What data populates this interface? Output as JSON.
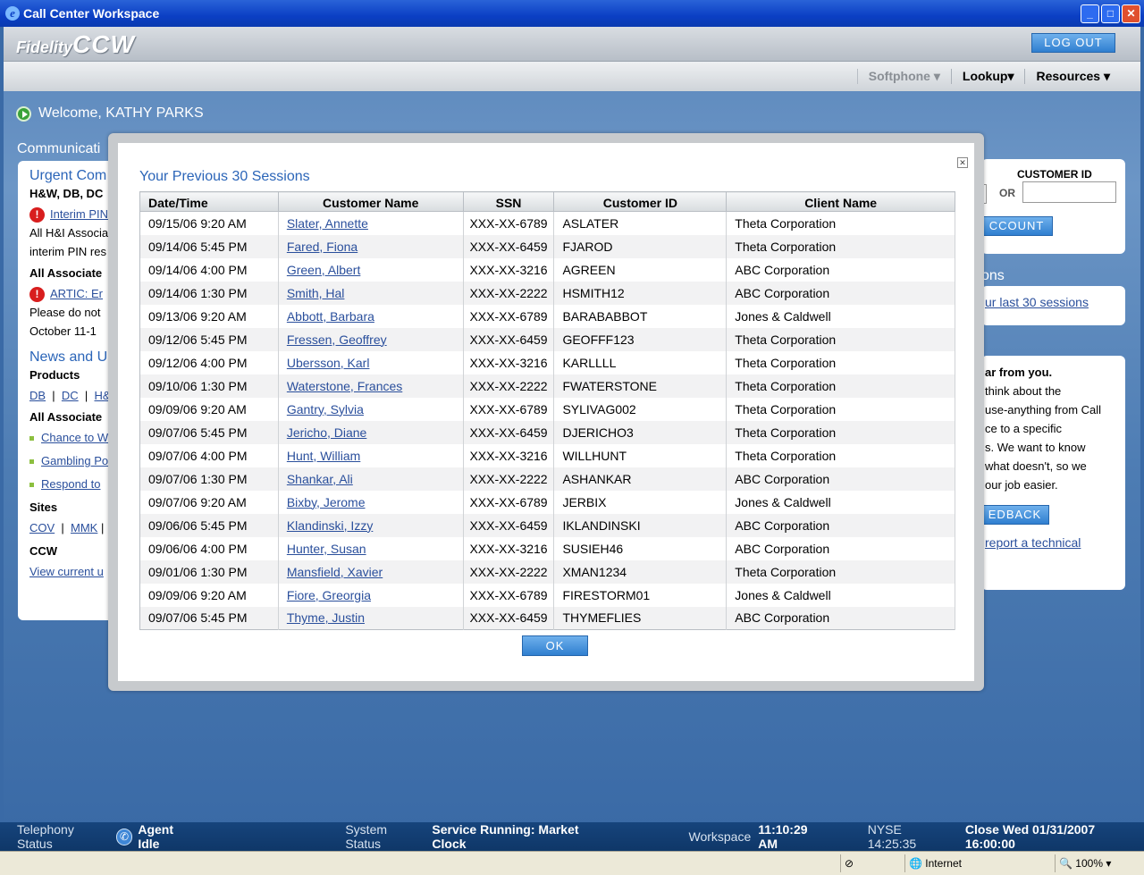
{
  "window": {
    "title": "Call Center Workspace"
  },
  "header": {
    "logo_fidelity": "Fidelity",
    "logo_ccw": "CCW",
    "logout_label": "LOG OUT",
    "nav": [
      "Softphone",
      "Lookup",
      "Resources"
    ]
  },
  "welcome": "Welcome, KATHY PARKS",
  "left_panel": {
    "section_title": "Communicati",
    "urgent_title": "Urgent Com",
    "urgent_sub": "H&W, DB, DC",
    "interim_link": "Interim PIN",
    "line1": "All H&I Associa",
    "line2": "interim PIN res",
    "all_assoc": "All Associate",
    "artic_link": "ARTIC: Er",
    "please": "Please do not",
    "october": "October 11-1",
    "news_title": "News and U",
    "products": "Products",
    "product_links": [
      "DB",
      "DC",
      "H&"
    ],
    "all_assoc2": "All Associate",
    "bullets": [
      "Chance to W",
      "Gambling Po",
      "Respond to"
    ],
    "sites": "Sites",
    "site_links": [
      "COV",
      "MMK"
    ],
    "ccw": "CCW",
    "view_current": "View current u"
  },
  "right_panel": {
    "customer_id_label": "CUSTOMER ID",
    "or": "OR",
    "account_btn": "CCOUNT",
    "sessions_title": "ons",
    "last30_link": "ur last 30 sessions",
    "hear_bold": "ar from you.",
    "lines": [
      "think about the",
      "use-anything from Call",
      "ce to a specific",
      "s.  We want to know",
      "what doesn't, so we",
      "our job easier."
    ],
    "feedback_btn": "EDBACK",
    "report_link": "report a technical"
  },
  "modal": {
    "title": "Your Previous 30 Sessions",
    "columns": [
      "Date/Time",
      "Customer Name",
      "SSN",
      "Customer ID",
      "Client Name"
    ],
    "rows": [
      [
        "09/15/06 9:20 AM",
        "Slater, Annette",
        "XXX-XX-6789",
        "ASLATER",
        "Theta Corporation"
      ],
      [
        "09/14/06 5:45 PM",
        "Fared, Fiona",
        "XXX-XX-6459",
        "FJAROD",
        "Theta Corporation"
      ],
      [
        "09/14/06 4:00 PM",
        "Green, Albert",
        "XXX-XX-3216",
        "AGREEN",
        "ABC Corporation"
      ],
      [
        "09/14/06 1:30 PM",
        "Smith, Hal",
        "XXX-XX-2222",
        "HSMITH12",
        "ABC Corporation"
      ],
      [
        "09/13/06 9:20 AM",
        "Abbott, Barbara",
        "XXX-XX-6789",
        "BARABABBOT",
        "Jones & Caldwell"
      ],
      [
        "09/12/06 5:45 PM",
        "Fressen, Geoffrey",
        "XXX-XX-6459",
        "GEOFFF123",
        "Theta Corporation"
      ],
      [
        "09/12/06 4:00 PM",
        "Ubersson, Karl",
        "XXX-XX-3216",
        "KARLLLL",
        "Theta Corporation"
      ],
      [
        "09/10/06 1:30 PM",
        "Waterstone, Frances",
        "XXX-XX-2222",
        "FWATERSTONE",
        "Theta Corporation"
      ],
      [
        "09/09/06 9:20 AM",
        "Gantry, Sylvia",
        "XXX-XX-6789",
        "SYLIVAG002",
        "Theta Corporation"
      ],
      [
        "09/07/06 5:45 PM",
        "Jericho, Diane",
        "XXX-XX-6459",
        "DJERICHO3",
        "Theta Corporation"
      ],
      [
        "09/07/06 4:00 PM",
        "Hunt, William",
        "XXX-XX-3216",
        "WILLHUNT",
        "Theta Corporation"
      ],
      [
        "09/07/06 1:30 PM",
        "Shankar, Ali",
        "XXX-XX-2222",
        "ASHANKAR",
        "ABC Corporation"
      ],
      [
        "09/07/06 9:20 AM",
        "Bixby, Jerome",
        "XXX-XX-6789",
        "JERBIX",
        "Jones & Caldwell"
      ],
      [
        "09/06/06 5:45 PM",
        "Klandinski, Izzy",
        "XXX-XX-6459",
        "IKLANDINSKI",
        "ABC Corporation"
      ],
      [
        "09/06/06 4:00 PM",
        "Hunter, Susan",
        "XXX-XX-3216",
        "SUSIEH46",
        "ABC Corporation"
      ],
      [
        "09/01/06 1:30 PM",
        "Mansfield, Xavier",
        "XXX-XX-2222",
        "XMAN1234",
        "Theta Corporation"
      ],
      [
        "09/09/06 9:20 AM",
        "Fiore, Greorgia",
        "XXX-XX-6789",
        "FIRESTORM01",
        "Jones & Caldwell"
      ],
      [
        "09/07/06 5:45 PM",
        "Thyme, Justin",
        "XXX-XX-6459",
        "THYMEFLIES",
        "ABC Corporation"
      ]
    ],
    "ok_label": "OK"
  },
  "status": {
    "telephony_label": "Telephony Status",
    "telephony_value": "Agent Idle",
    "system_label": "System Status",
    "system_value": "Service Running: Market Clock",
    "workspace_label": "Workspace",
    "workspace_time": "11:10:29 AM",
    "nyse": "NYSE 14:25:35",
    "close": "Close Wed 01/31/2007 16:00:00"
  },
  "ie_status": {
    "zone": "Internet",
    "zoom": "100%"
  }
}
